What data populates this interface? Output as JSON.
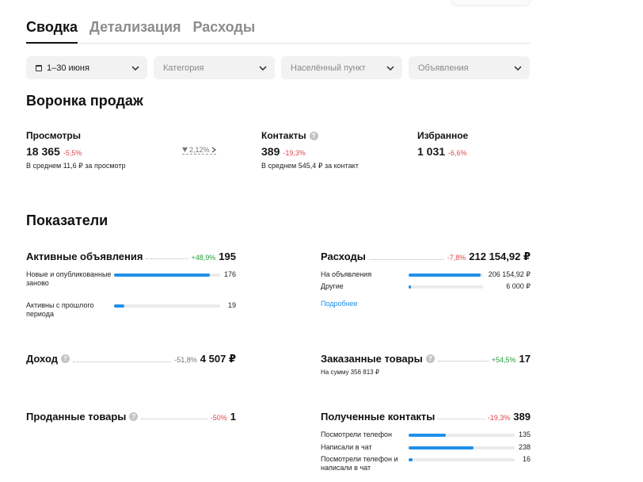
{
  "tabs": [
    {
      "label": "Сводка",
      "active": true
    },
    {
      "label": "Детализация",
      "active": false
    },
    {
      "label": "Расходы",
      "active": false
    }
  ],
  "filters": {
    "period": "1–30 июня",
    "category_placeholder": "Категория",
    "city_placeholder": "Населённый пункт",
    "ads_placeholder": "Объявления"
  },
  "funnel": {
    "title": "Воронка продаж",
    "views": {
      "label": "Просмотры",
      "value": "18 365",
      "change": "-5,5%",
      "sub": "В среднем 11,6 ₽ за просмотр"
    },
    "conversion": "2,12%",
    "contacts": {
      "label": "Контакты",
      "value": "389",
      "change": "-19,3%",
      "sub": "В среднем 545,4 ₽ за контакт"
    },
    "favorites": {
      "label": "Избранное",
      "value": "1 031",
      "change": "-6,6%"
    }
  },
  "indicators": {
    "title": "Показатели",
    "active_ads": {
      "label": "Активные объявления",
      "change": "+48,9%",
      "value": "195",
      "rows": [
        {
          "label": "Новые и опубликованные заново",
          "value": "176",
          "fill": 0.9
        },
        {
          "label": "Активны с прошлого периода",
          "value": "19",
          "fill": 0.1
        }
      ]
    },
    "expenses": {
      "label": "Расходы",
      "change": "-7,8%",
      "value": "212 154,92 ₽",
      "rows": [
        {
          "label": "На объявления",
          "value": "206 154,92 ₽",
          "fill": 0.97
        },
        {
          "label": "Другие",
          "value": "6 000 ₽",
          "fill": 0.03
        }
      ],
      "link": "Подробнее"
    },
    "income": {
      "label": "Доход",
      "change": "-51,8%",
      "value": "4 507 ₽"
    },
    "ordered": {
      "label": "Заказанные товары",
      "change": "+54,5%",
      "value": "17",
      "note": "На сумму 356 813 ₽"
    },
    "sold": {
      "label": "Проданные товары",
      "change": "-50%",
      "value": "1"
    },
    "received_contacts": {
      "label": "Полученные контакты",
      "change": "-19,3%",
      "value": "389",
      "rows": [
        {
          "label": "Посмотрели телефон",
          "value": "135",
          "fill": 0.35
        },
        {
          "label": "Написали в чат",
          "value": "238",
          "fill": 0.61
        },
        {
          "label": "Посмотрели телефон и написали в чат",
          "value": "16",
          "fill": 0.04
        }
      ]
    }
  },
  "colors": {
    "accent": "#1f8fe8",
    "negative": "#e0474c",
    "positive": "#21a038"
  }
}
